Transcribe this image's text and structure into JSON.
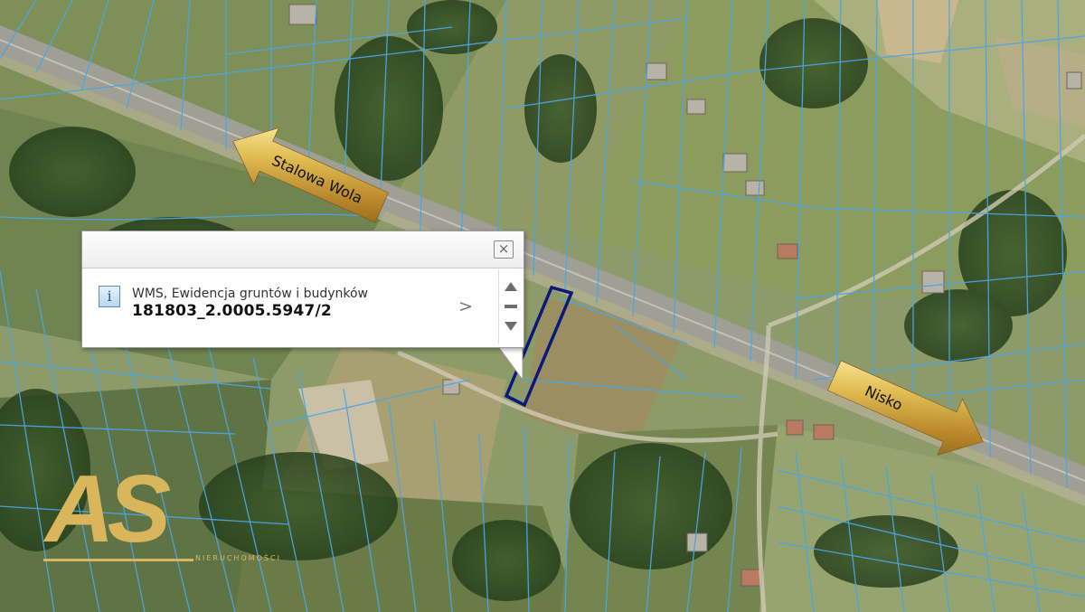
{
  "map": {
    "direction_arrows": [
      {
        "label": "Stalowa Wola",
        "points_to": "northwest"
      },
      {
        "label": "Nisko",
        "points_to": "southeast"
      }
    ],
    "parcel_outline_color": "#0b1a7a",
    "parcel_boundary_color": "#4aa6e6"
  },
  "popup": {
    "info_icon": "i",
    "layer_name": "WMS, Ewidencja gruntów i budynków",
    "parcel_id": "181803_2.0005.5947/2",
    "close_glyph": "×",
    "next_glyph": ">"
  },
  "logo": {
    "text": "AS",
    "subtitle": "NIERUCHOMOŚCI",
    "color": "#d9b65c"
  }
}
